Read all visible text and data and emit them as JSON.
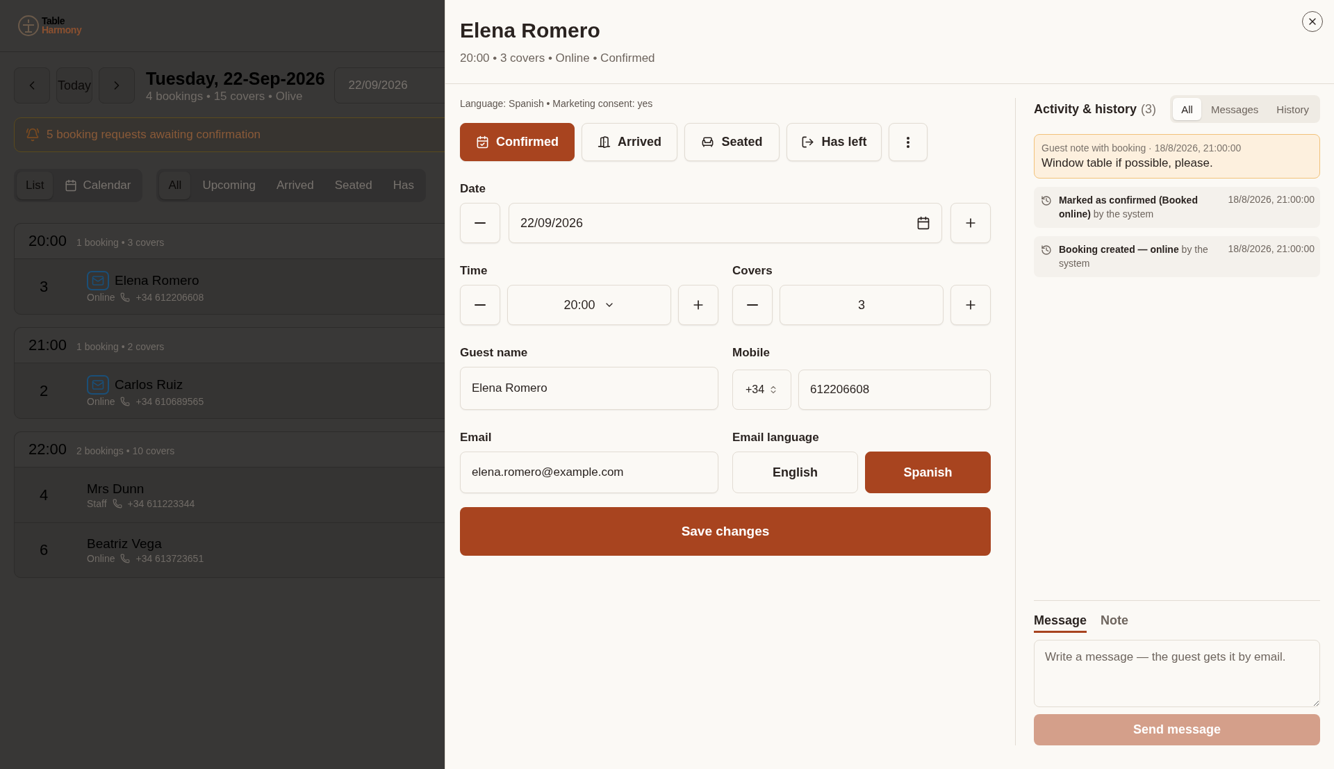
{
  "logo": {
    "line_1": "Table",
    "line_2": "Harmony"
  },
  "day_nav": {
    "today": "Today",
    "title": "Tuesday, 22-Sep-2026",
    "summary": "4 bookings • 15 covers • Olive",
    "date_field": "22/09/2026"
  },
  "banner": {
    "text": "5 booking requests awaiting confirmation"
  },
  "view_tabs": [
    {
      "label": "List",
      "kind": "plain",
      "selected": true
    },
    {
      "label": "Calendar",
      "kind": "calendar",
      "selected": false
    }
  ],
  "status_filters": [
    {
      "label": "All",
      "selected": true
    },
    {
      "label": "Upcoming",
      "selected": false
    },
    {
      "label": "Arrived",
      "selected": false
    },
    {
      "label": "Seated",
      "selected": false
    },
    {
      "label": "Has",
      "selected": false
    }
  ],
  "groups": [
    {
      "time": "20:00",
      "summary": "1 booking • 3 covers",
      "bookings": [
        {
          "covers": "3",
          "name": "Elena Romero",
          "source": "Online",
          "phone": "+34 612206608",
          "has_email": true
        }
      ]
    },
    {
      "time": "21:00",
      "summary": "1 booking • 2 covers",
      "bookings": [
        {
          "covers": "2",
          "name": "Carlos Ruiz",
          "source": "Online",
          "phone": "+34 610689565",
          "has_email": true
        }
      ]
    },
    {
      "time": "22:00",
      "summary": "2 bookings • 10 covers",
      "bookings": [
        {
          "covers": "4",
          "name": "Mrs Dunn",
          "source": "Staff",
          "phone": "+34 611223344",
          "has_email": false
        },
        {
          "covers": "6",
          "name": "Beatriz Vega",
          "source": "Online",
          "phone": "+34 613723651",
          "has_email": false
        }
      ]
    }
  ],
  "drawer": {
    "title": "Elena Romero",
    "subtitle": "20:00 • 3 covers • Online • Confirmed",
    "meta": "Language: Spanish • Marketing consent: yes",
    "status_buttons": [
      {
        "label": "Confirmed",
        "kind": "confirmed",
        "selected": true
      },
      {
        "label": "Arrived",
        "kind": "arrived",
        "selected": false
      },
      {
        "label": "Seated",
        "kind": "seated",
        "selected": false
      },
      {
        "label": "Has left",
        "kind": "left",
        "selected": false
      }
    ],
    "date": {
      "label": "Date",
      "value": "22/09/2026"
    },
    "time": {
      "label": "Time",
      "value": "20:00"
    },
    "covers": {
      "label": "Covers",
      "value": "3"
    },
    "guest_name": {
      "label": "Guest name",
      "value": "Elena Romero"
    },
    "mobile": {
      "label": "Mobile",
      "country_code": "+34",
      "value": "612206608"
    },
    "email": {
      "label": "Email",
      "value": "elena.romero@example.com"
    },
    "email_language": {
      "label": "Email language",
      "options": [
        {
          "label": "English",
          "selected": false
        },
        {
          "label": "Spanish",
          "selected": true
        }
      ]
    },
    "save_button": "Save changes"
  },
  "activity": {
    "title": "Activity & history",
    "count": "(3)",
    "tabs": [
      {
        "label": "All",
        "selected": true
      },
      {
        "label": "Messages",
        "selected": false
      },
      {
        "label": "History",
        "selected": false
      }
    ],
    "note": {
      "meta": "Guest note with booking · 18/8/2026, 21:00:00",
      "text": "Window table if possible, please."
    },
    "events": [
      {
        "text": "**Marked as confirmed (Booked online)** by the system",
        "time": "18/8/2026, 21:00:00"
      },
      {
        "text": "**Booking created — online** by the system",
        "time": "18/8/2026, 21:00:00"
      }
    ]
  },
  "composer": {
    "tabs": [
      {
        "label": "Message",
        "selected": true
      },
      {
        "label": "Note",
        "selected": false
      }
    ],
    "placeholder": "Write a message — the guest gets it by email.",
    "send_button": "Send message",
    "send_disabled": true
  }
}
